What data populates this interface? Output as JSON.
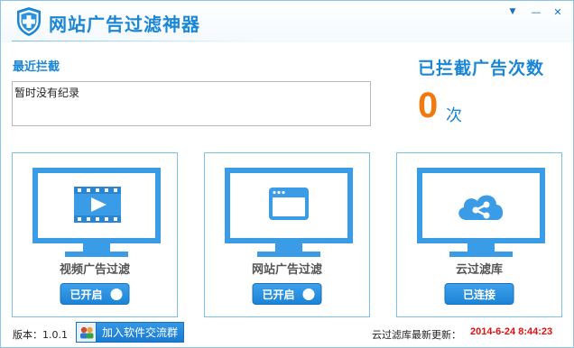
{
  "app": {
    "title": "网站广告过滤神器"
  },
  "window_controls": {
    "menu_glyph": "▼",
    "minimize_glyph": "—",
    "close_glyph": "✕"
  },
  "recent": {
    "label": "最近拦截",
    "empty_text": "暂时没有纪录"
  },
  "stats": {
    "label": "已拦截广告次数",
    "count": "0",
    "unit": "次"
  },
  "cards": [
    {
      "icon": "video-icon",
      "title": "视频广告过滤",
      "status": "已开启"
    },
    {
      "icon": "browser-window-icon",
      "title": "网站广告过滤",
      "status": "已开启"
    },
    {
      "icon": "cloud-share-icon",
      "title": "云过滤库",
      "status": "已连接"
    }
  ],
  "footer": {
    "version": "版本：1.0.1",
    "join_group": "加入软件交流群",
    "update_label": "云过滤库最新更新：",
    "update_time": "2014-6-24  8:44:23"
  },
  "colors": {
    "accent": "#1a86d6",
    "count": "#f07a10",
    "update_time": "#e01010",
    "card_border": "#7cc1ec"
  }
}
